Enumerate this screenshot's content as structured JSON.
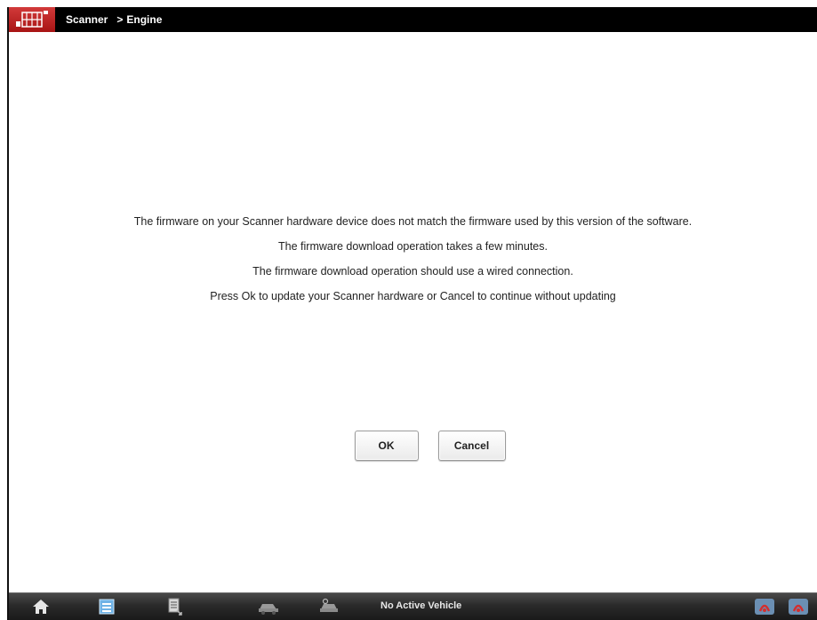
{
  "titlebar": {
    "breadcrumb_root": "Scanner",
    "breadcrumb_separator": ">",
    "breadcrumb_current": "Engine"
  },
  "dialog": {
    "lines": [
      "The firmware on your Scanner hardware device does not match the firmware used by this version of the software.",
      "The firmware download operation takes a few minutes.",
      "The firmware download operation should use a wired connection.",
      "Press Ok to update your Scanner hardware or Cancel to continue without updating"
    ],
    "ok_label": "OK",
    "cancel_label": "Cancel"
  },
  "toolbar": {
    "status_text": "No Active Vehicle",
    "icons": [
      "home-icon",
      "list-icon",
      "document-icon",
      "vehicle-icon",
      "vehicle-settings-icon",
      "connection-icon",
      "connection-alt-icon"
    ]
  },
  "colors": {
    "titlebar_bg": "#000000",
    "logo_red": "#c62828",
    "toolbar_bg": "#2a2a2a",
    "connection_icon_red": "#d32f2f"
  }
}
